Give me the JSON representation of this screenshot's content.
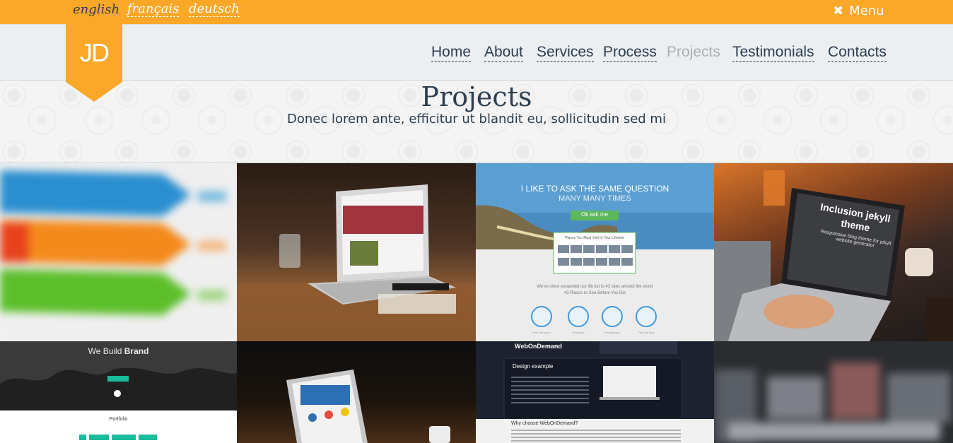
{
  "languages": [
    {
      "label": "english",
      "current": true
    },
    {
      "label": "français",
      "current": false
    },
    {
      "label": "deutsch",
      "current": false
    }
  ],
  "menu": {
    "label": "Menu",
    "icon": "close-icon"
  },
  "logo": {
    "text": "JD"
  },
  "nav": [
    {
      "label": "Home",
      "active": false
    },
    {
      "label": "About",
      "active": false
    },
    {
      "label": "Services",
      "active": false
    },
    {
      "label": "Process",
      "active": false
    },
    {
      "label": "Projects",
      "active": true
    },
    {
      "label": "Testimonials",
      "active": false
    },
    {
      "label": "Contacts",
      "active": false
    }
  ],
  "hero": {
    "title": "Projects",
    "subtitle": "Donec lorem ante, efficitur ut blandit eu, sollicitudin sed mi"
  },
  "tiles": {
    "t3": {
      "headline": "I LIKE TO ASK THE SAME QUESTION",
      "subheadline": "MANY MANY TIMES",
      "button": "Ok ask me",
      "card_title": "Places You Must Visit In Your Lifetime",
      "line1": "We've since expanded our life list to 43 sites around the world",
      "line2": "43 Places to See Before You Die",
      "icon_labels": [
        "Web the world",
        "Shopping",
        "Photography",
        "Find the best"
      ]
    },
    "t4": {
      "title1": "Inclusion jekyll",
      "title2": "theme",
      "caption": "Responsive blog theme for jekyll website generator"
    },
    "t5": {
      "headline_pre": "We Build ",
      "headline_bold": "Brand",
      "section": "Portfolio"
    },
    "t7": {
      "brand": "WebOnDemand",
      "heading": "Design example",
      "why": "Why choose WebOnDemand?"
    }
  },
  "colors": {
    "accent": "#fba829",
    "text": "#2c3e50",
    "header_bg": "#eceff1",
    "nav_active": "#a8b0b6"
  }
}
